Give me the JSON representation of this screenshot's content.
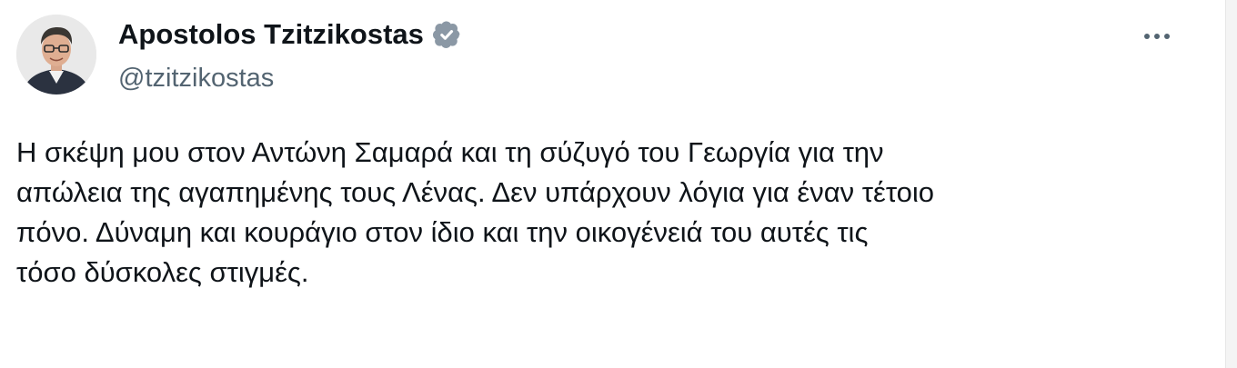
{
  "author": {
    "display_name": "Apostolos Tzitzikostas",
    "handle": "@tzitzikostas",
    "verified": true
  },
  "icons": {
    "verified": "verified-badge-icon",
    "more": "more-options-icon"
  },
  "colors": {
    "text": "#0f1419",
    "secondary": "#536471",
    "verified_badge": "#8b98a5"
  },
  "tweet": {
    "lines": [
      "Η σκέψη μου στον Αντώνη Σαμαρά και τη σύζυγό του Γεωργία για την",
      "απώλεια της αγαπημένης τους Λένας. Δεν υπάρχουν λόγια για έναν τέτοιο",
      "πόνο. Δύναμη και κουράγιο στον ίδιο και την οικογένειά του αυτές τις",
      "τόσο δύσκολες στιγμές."
    ]
  }
}
